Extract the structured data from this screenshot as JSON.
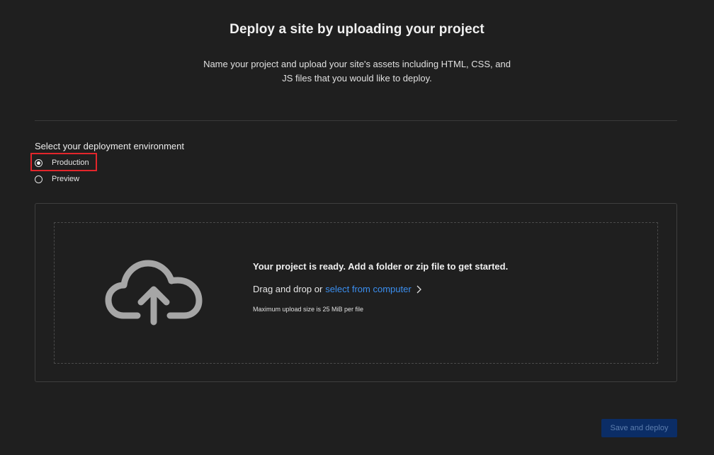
{
  "header": {
    "title": "Deploy a site by uploading your project",
    "subtitle": "Name your project and upload your site's assets including HTML, CSS, and JS files that you would like to deploy."
  },
  "environment": {
    "label": "Select your deployment environment",
    "options": [
      {
        "label": "Production",
        "selected": true
      },
      {
        "label": "Preview",
        "selected": false
      }
    ]
  },
  "upload": {
    "icon": "cloud-upload-icon",
    "heading": "Your project is ready. Add a folder or zip file to get started.",
    "drag_text": "Drag and drop or",
    "link_text": "select from computer",
    "note": "Maximum upload size is 25 MiB per file"
  },
  "actions": {
    "deploy_label": "Save and deploy"
  },
  "colors": {
    "background": "#1f1f1f",
    "link": "#3b8ff0",
    "highlight": "#e3262b",
    "button_bg": "#0b2d66"
  }
}
